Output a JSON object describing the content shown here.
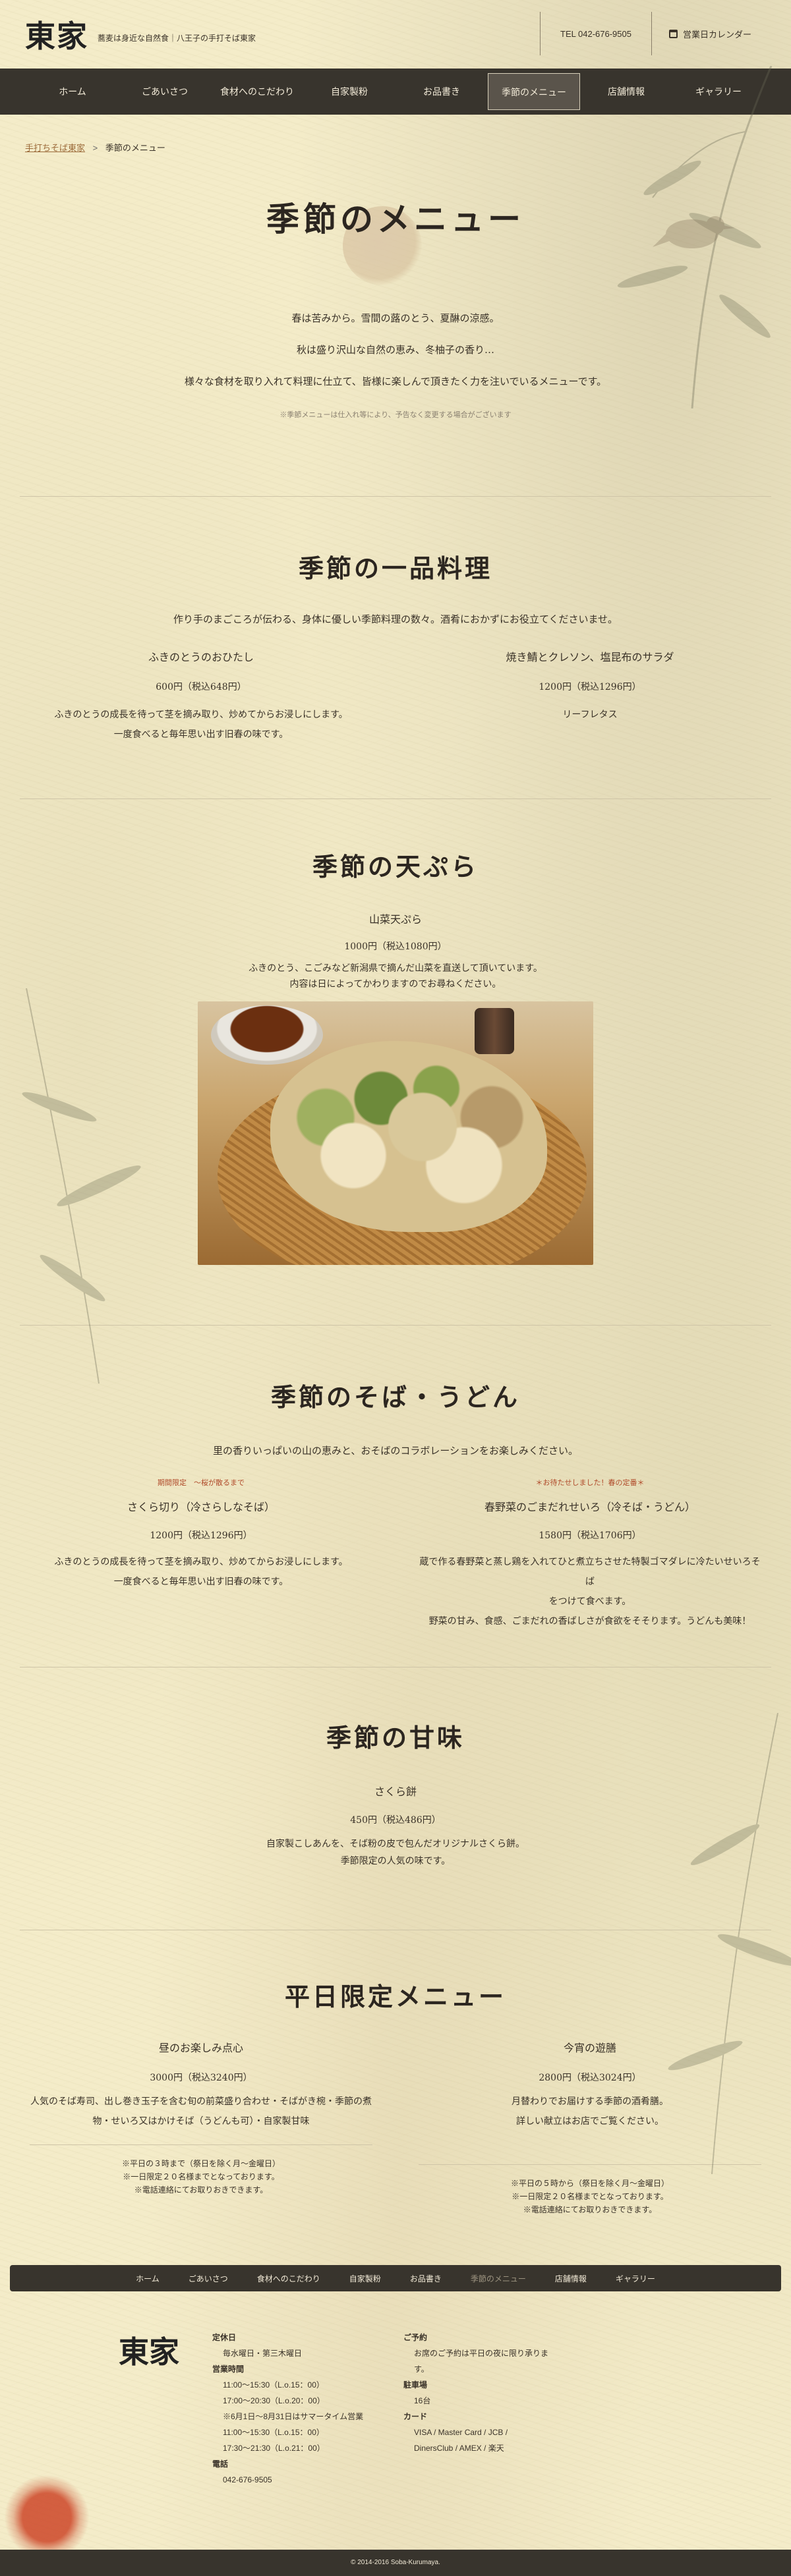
{
  "header": {
    "logo": "東家",
    "tagline": "蕎麦は身近な自然食｜八王子の手打そば東家",
    "tel": "TEL 042-676-9505",
    "calendar_label": "営業日カレンダー"
  },
  "nav": [
    "ホーム",
    "ごあいさつ",
    "食材へのこだわり",
    "自家製粉",
    "お品書き",
    "季節のメニュー",
    "店舗情報",
    "ギャラリー"
  ],
  "breadcrumb": {
    "home": "手打ちそば東家",
    "sep": ">",
    "current": "季節のメニュー"
  },
  "hero": {
    "title": "季節のメニュー",
    "intro": [
      "春は苦みから。雪間の蕗のとう、夏醂の涼感。",
      "秋は盛り沢山な自然の恵み、冬柚子の香り…",
      "様々な食材を取り入れて料理に仕立て、皆様に楽しんで頂きたく力を注いでいるメニューです。"
    ],
    "note": "※季節メニューは仕入れ等により、予告なく変更する場合がございます"
  },
  "ippin": {
    "title": "季節の一品料理",
    "lead": "作り手のまごころが伝わる、身体に優しい季節料理の数々。酒肴におかずにお役立てくださいませ。",
    "items": [
      {
        "name": "ふきのとうのおひたし",
        "price": "600円（税込648円）",
        "desc": [
          "ふきのとうの成長を待って茎を摘み取り、炒めてからお浸しにします。",
          "一度食べると毎年思い出す旧春の味です。"
        ]
      },
      {
        "name": "焼き鯖とクレソン、塩昆布のサラダ",
        "price": "1200円（税込1296円）",
        "desc": [
          "リーフレタス"
        ]
      }
    ]
  },
  "tempura": {
    "title": "季節の天ぷら",
    "item": {
      "name": "山菜天ぷら",
      "price": "1000円（税込1080円）",
      "desc": [
        "ふきのとう、こごみなど新潟県で摘んだ山菜を直送して頂いています。",
        "内容は日によってかわりますのでお尋ねください。"
      ]
    },
    "image_label": "山菜天ぷらの写真"
  },
  "soba": {
    "title": "季節のそば・うどん",
    "lead": "里の香りいっぱいの山の恵みと、おそばのコラボレーションをお楽しみください。",
    "items": [
      {
        "badge": "期間限定　～桜が散るまで",
        "name": "さくら切り（冷さらしなそば）",
        "price": "1200円（税込1296円）",
        "desc": [
          "ふきのとうの成長を待って茎を摘み取り、炒めてからお浸しにします。",
          "一度食べると毎年思い出す旧春の味です。"
        ]
      },
      {
        "badge": "＊お待たせしました！春の定番＊",
        "name": "春野菜のごまだれせいろ（冷そば・うどん）",
        "price": "1580円（税込1706円）",
        "desc": [
          "蔵で作る春野菜と蒸し鶏を入れてひと煮立ちさせた特製ゴマダレに冷たいせいろそば",
          "をつけて食べます。",
          "野菜の甘み、食感、ごまだれの香ばしさが食欲をそそります。うどんも美味！"
        ]
      }
    ]
  },
  "sweets": {
    "title": "季節の甘味",
    "item": {
      "name": "さくら餅",
      "price": "450円（税込486円）",
      "desc": [
        "自家製こしあんを、そば粉の皮で包んだオリジナルさくら餅。",
        "季節限定の人気の味です。"
      ]
    }
  },
  "weekday": {
    "title": "平日限定メニュー",
    "items": [
      {
        "name": "昼のお楽しみ点心",
        "price": "3000円（税込3240円）",
        "desc": [
          "人気のそば寿司、出し巻き玉子を含む旬の前菜盛り合わせ・そばがき椀・季節の煮",
          "物・せいろ又はかけそば（うどんも可）・自家製甘味"
        ],
        "notes": [
          "※平日の３時まで（祭日を除く月～金曜日）",
          "※一日限定２０名様までとなっております。",
          "※電話連絡にてお取りおきできます。"
        ]
      },
      {
        "name": "今宵の遊膳",
        "price": "2800円（税込3024円）",
        "desc": [
          "月替わりでお届けする季節の酒肴膳。",
          "詳しい献立はお店でご覧ください。"
        ],
        "notes": [
          "※平日の５時から（祭日を除く月～金曜日）",
          "※一日限定２０名様までとなっております。",
          "※電話連絡にてお取りおきできます。"
        ]
      }
    ]
  },
  "footer_nav": [
    "ホーム",
    "ごあいさつ",
    "食材へのこだわり",
    "自家製粉",
    "お品書き",
    "季節のメニュー",
    "店舗情報",
    "ギャラリー"
  ],
  "footer": {
    "logo": "東家",
    "closed_label": "定休日",
    "closed": "毎水曜日・第三木曜日",
    "hours_label": "営業時間",
    "hours": [
      "11:00～15:30（L.o.15：00）",
      "17:00～20:30（L.o.20：00）",
      "※6月1日～8月31日はサマータイム営業",
      "11:00～15:30（L.o.15：00）",
      "17:30～21:30（L.o.21：00）"
    ],
    "tel_label": "電話",
    "tel": "042-676-9505",
    "reserve_label": "ご予約",
    "reserve": [
      "お席のご予約は平日の夜に限り承りま",
      "す。"
    ],
    "parking_label": "駐車場",
    "parking": "16台",
    "card_label": "カード",
    "cards": [
      "VISA / Master Card / JCB /",
      "DinersClub / AMEX / 楽天"
    ],
    "copyright": "© 2014-2016 Soba-Kurumaya."
  },
  "colors": {
    "nav_bg": "#38342d",
    "page_bg": "#f4ecc9",
    "accent": "#9c6b3a",
    "badge": "#b04a2a"
  }
}
